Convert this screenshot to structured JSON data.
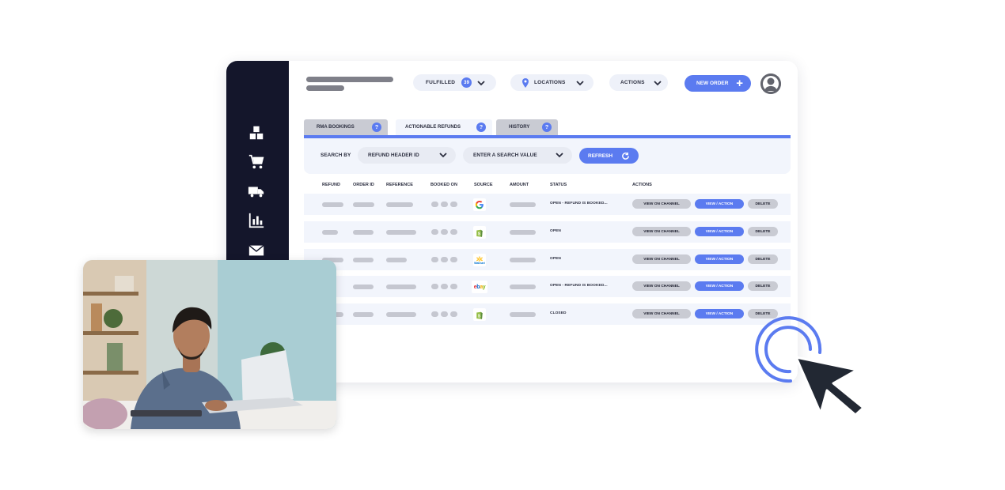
{
  "header": {
    "filter_label": "FULFILLED",
    "filter_count": "39",
    "locations_label": "LOCATIONS",
    "actions_label": "ACTIONS",
    "new_order_label": "NEW ORDER",
    "new_order_icon": "+"
  },
  "sidebar": {
    "items": [
      {
        "icon": "boxes-icon"
      },
      {
        "icon": "cart-icon"
      },
      {
        "icon": "truck-icon"
      },
      {
        "icon": "chart-icon"
      },
      {
        "icon": "mail-icon"
      }
    ]
  },
  "tabs": [
    {
      "label": "RMA BOOKINGS",
      "help": "?"
    },
    {
      "label": "ACTIONABLE REFUNDS",
      "help": "?"
    },
    {
      "label": "HISTORY",
      "help": "?"
    }
  ],
  "search": {
    "search_by_label": "SEARCH BY",
    "field_label": "REFUND HEADER ID",
    "value_placeholder": "ENTER A SEARCH VALUE",
    "refresh_label": "REFRESH"
  },
  "table": {
    "headers": [
      "REFUND",
      "ORDER ID",
      "REFERENCE",
      "BOOKED ON",
      "SOURCE",
      "AMOUNT",
      "STATUS",
      "ACTIONS"
    ],
    "rows": [
      {
        "source": "google",
        "status": "OPEN - REFUND IS BOOKED..."
      },
      {
        "source": "shopify",
        "status": "OPEN"
      },
      {
        "source": "walmart",
        "status": "OPEN"
      },
      {
        "source": "ebay",
        "status": "OPEN - REFUND IS BOOKED..."
      },
      {
        "source": "shopify",
        "status": "CLOSED"
      }
    ],
    "action_channel": "VIEW ON CHANNEL",
    "action_view": "VIEW / ACTION",
    "action_delete": "DELETE"
  },
  "source_labels": {
    "walmart": "Walmart",
    "ebay": "ebay"
  },
  "colors": {
    "accent": "#5b7bf0",
    "sidebar": "#14162b",
    "placeholder": "#c5c7d0",
    "row_bg": "#f2f5fc"
  }
}
